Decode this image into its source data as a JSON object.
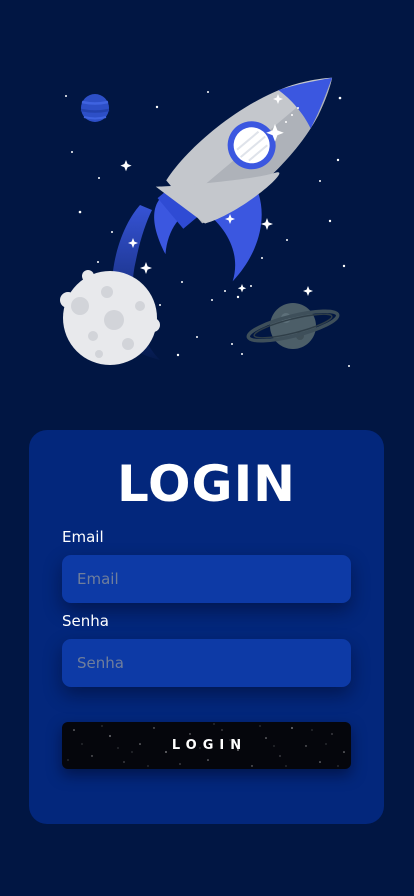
{
  "login": {
    "title": "LOGIN",
    "email_label": "Email",
    "email_placeholder": "Email",
    "email_value": "",
    "password_label": "Senha",
    "password_placeholder": "Senha",
    "password_value": "",
    "submit_label": "LOGIN"
  },
  "icons": {
    "hero": "rocket-illustration",
    "moon": "moon-icon",
    "planet": "ringed-planet-icon",
    "small_planet": "small-planet-icon",
    "stars": "sparkle-icon"
  },
  "colors": {
    "background": "#011643",
    "card": "#03277c",
    "input": "#0d3aa6",
    "accent": "#3b57e0",
    "button": "#05060c"
  }
}
